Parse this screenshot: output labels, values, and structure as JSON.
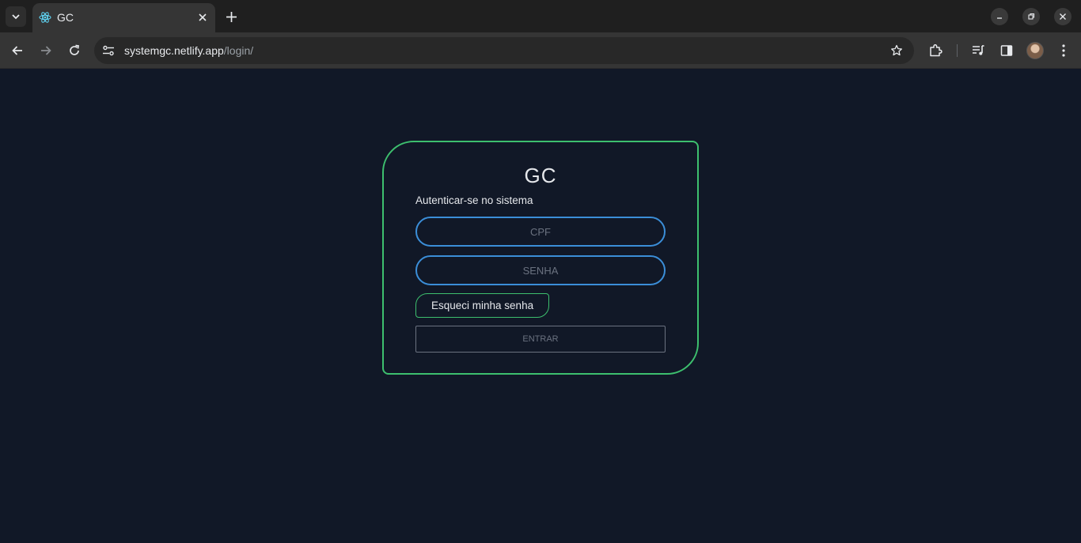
{
  "browser": {
    "tab_title": "GC",
    "url_host": "systemgc.netlify.app",
    "url_path": "/login/"
  },
  "login": {
    "title": "GC",
    "subtitle": "Autenticar-se no sistema",
    "cpf_placeholder": "CPF",
    "senha_placeholder": "SENHA",
    "forgot_label": "Esqueci minha senha",
    "submit_label": "ENTRAR"
  },
  "colors": {
    "page_background": "#111827",
    "card_border": "#3dbf6e",
    "input_border": "#3b8ed8"
  }
}
